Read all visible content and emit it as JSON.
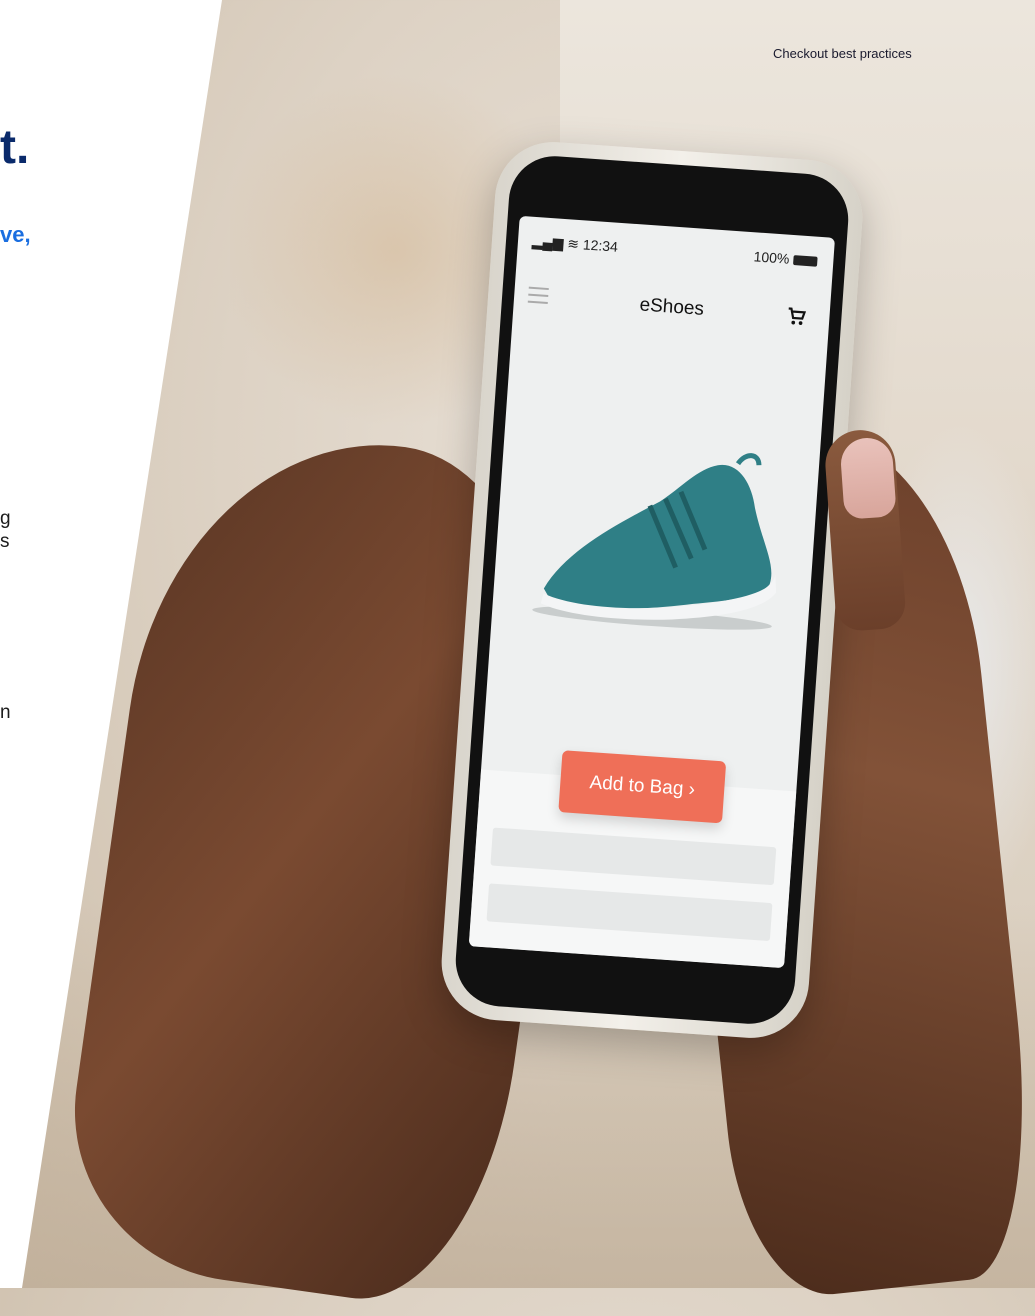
{
  "page": {
    "section_title": "Checkout best practices",
    "headline_fragment": "t.",
    "subhead_fragment": "ve,",
    "body_fragment_1": "g",
    "body_fragment_2": "s",
    "body_fragment_3": "n"
  },
  "phone": {
    "status_time": "12:34",
    "battery": "100%",
    "app_name": "eShoes",
    "cta_label": "Add to Bag",
    "cta_arrow": "›",
    "colors": {
      "cta": "#ef6f58",
      "headline": "#0a2a6b",
      "subhead": "#1a6ee0",
      "shoe": "#2f7f86"
    }
  }
}
